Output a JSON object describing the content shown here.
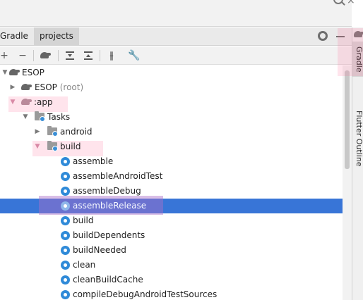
{
  "header": {
    "search_icon": "search-icon",
    "close_icon": "close-icon"
  },
  "tabs": {
    "gradle_label": "Gradle",
    "projects_label": "projects"
  },
  "toolbar": {
    "add_icon": "+",
    "remove_icon": "−",
    "gradle_icon": "elephant-icon",
    "expand_icon": "expand-all-icon",
    "collapse_icon": "collapse-all-icon",
    "toggle_offline_icon": "offline-toggle-icon",
    "settings_icon": "wrench-icon"
  },
  "tree": {
    "rows": [
      {
        "label": "ESOP",
        "suffix": "",
        "icon": "elephant",
        "arrow": "down",
        "depth": 0
      },
      {
        "label": "ESOP",
        "suffix": "(root)",
        "icon": "elephant",
        "arrow": "right",
        "depth": 1
      },
      {
        "label": ":app",
        "suffix": "",
        "icon": "elephant",
        "arrow": "down",
        "depth": 1
      },
      {
        "label": "Tasks",
        "suffix": "",
        "icon": "folder",
        "arrow": "down",
        "depth": 2
      },
      {
        "label": "android",
        "suffix": "",
        "icon": "folder",
        "arrow": "right",
        "depth": 3
      },
      {
        "label": "build",
        "suffix": "",
        "icon": "folder",
        "arrow": "down",
        "depth": 3
      },
      {
        "label": "assemble",
        "suffix": "",
        "icon": "cog",
        "arrow": "",
        "depth": 4
      },
      {
        "label": "assembleAndroidTest",
        "suffix": "",
        "icon": "cog",
        "arrow": "",
        "depth": 4
      },
      {
        "label": "assembleDebug",
        "suffix": "",
        "icon": "cog",
        "arrow": "",
        "depth": 4
      },
      {
        "label": "assembleRelease",
        "suffix": "",
        "icon": "cog",
        "arrow": "",
        "depth": 4,
        "selected": true
      },
      {
        "label": "build",
        "suffix": "",
        "icon": "cog",
        "arrow": "",
        "depth": 4
      },
      {
        "label": "buildDependents",
        "suffix": "",
        "icon": "cog",
        "arrow": "",
        "depth": 4
      },
      {
        "label": "buildNeeded",
        "suffix": "",
        "icon": "cog",
        "arrow": "",
        "depth": 4
      },
      {
        "label": "clean",
        "suffix": "",
        "icon": "cog",
        "arrow": "",
        "depth": 4
      },
      {
        "label": "cleanBuildCache",
        "suffix": "",
        "icon": "cog",
        "arrow": "",
        "depth": 4
      },
      {
        "label": "compileDebugAndroidTestSources",
        "suffix": "",
        "icon": "cog",
        "arrow": "",
        "depth": 4
      }
    ]
  },
  "sidebar": {
    "gradle_label": "Gradle",
    "flutter_label": "Flutter Outline"
  },
  "colors": {
    "selection": "#3875d7",
    "task_icon": "#2f8ad8",
    "highlight": "#ff6996"
  }
}
